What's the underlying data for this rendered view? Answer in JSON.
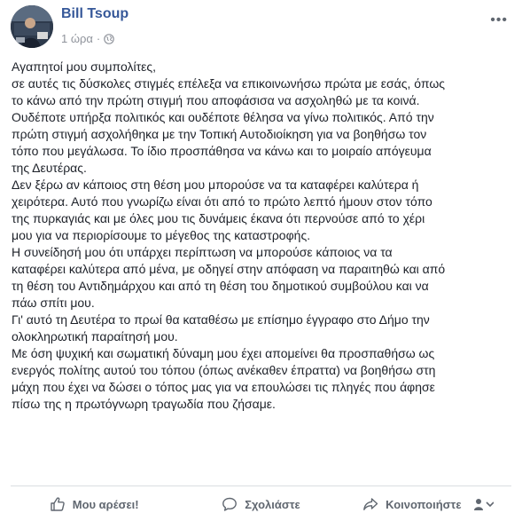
{
  "post": {
    "author": "Bill Tsoup",
    "timestamp": "1 ώρα",
    "separator": "·",
    "privacy_icon": "globe-icon",
    "options_label": "•••",
    "body_lines": [
      "Αγαπητοί μου συμπολίτες,",
      "σε αυτές τις δύσκολες στιγμές επέλεξα να επικοινωνήσω πρώτα με εσάς, όπως",
      "το κάνω από την πρώτη στιγμή που αποφάσισα να ασχοληθώ με τα κοινά.",
      "Ουδέποτε υπήρξα πολιτικός και ουδέποτε θέλησα να γίνω πολιτικός. Από την",
      "πρώτη στιγμή ασχολήθηκα με την Τοπική Αυτοδιοίκηση για να βοηθήσω τον",
      "τόπο που μεγάλωσα. Το ίδιο προσπάθησα να κάνω και το μοιραίο απόγευμα",
      "της Δευτέρας.",
      "Δεν ξέρω αν κάποιος στη θέση μου μπορούσε να τα καταφέρει καλύτερα ή",
      "χειρότερα. Αυτό που γνωρίζω είναι ότι από το πρώτο λεπτό ήμουν στον τόπο",
      "της πυρκαγιάς και με όλες μου τις δυνάμεις έκανα ότι περνούσε από το χέρι",
      "μου για να περιορίσουμε το μέγεθος της καταστροφής.",
      "Η συνείδησή μου ότι υπάρχει περίπτωση να μπορούσε κάποιος να τα",
      "καταφέρει καλύτερα από μένα, με οδηγεί στην απόφαση να παραιτηθώ και από",
      "τη θέση του Αντιδημάρχου και από τη θέση του δημοτικού συμβούλου και να",
      "πάω σπίτι μου.",
      "Γι' αυτό τη Δευτέρα το πρωί θα καταθέσω με επίσημο έγγραφο στο Δήμο την",
      "ολοκληρωτική παραίτησή μου.",
      "Με όση ψυχική και σωματική δύναμη μου έχει απομείνει θα προσπαθήσω ως",
      "ενεργός πολίτης αυτού του τόπου (όπως ανέκαθεν έπραττα) να βοηθήσω στη",
      "μάχη που έχει να δώσει ο τόπος μας για να επουλώσει τις πληγές που άφησε",
      "πίσω της η πρωτόγνωρη τραγωδία που ζήσαμε."
    ]
  },
  "actions": {
    "like_label": "Μου αρέσει!",
    "comment_label": "Σχολιάστε",
    "share_label": "Κοινοποιήστε"
  },
  "colors": {
    "author_link": "#365899",
    "meta_text": "#90949c",
    "body_text": "#1d2129",
    "action_text": "#606770",
    "divider": "#dadde1"
  }
}
